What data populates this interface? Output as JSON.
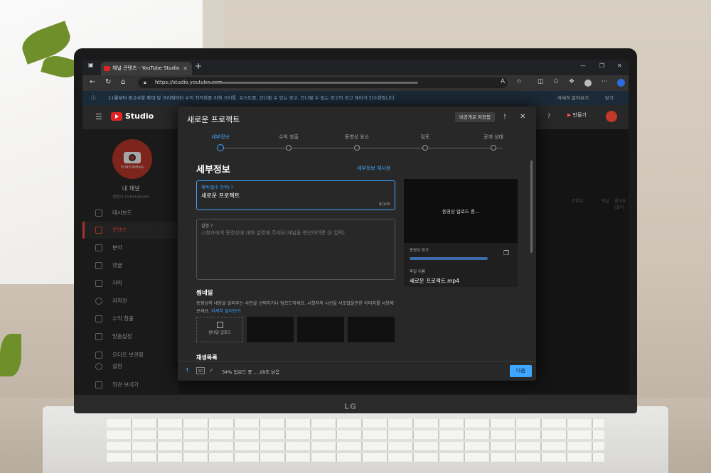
{
  "browser": {
    "tab_title": "채널 콘텐츠 - YouTube Studio",
    "tab_close": "✕",
    "new_tab": "+",
    "url": "https://studio.youtube.com",
    "nav_back": "←",
    "nav_reload": "↻",
    "nav_home": "⌂",
    "win_min": "—",
    "win_max": "❐",
    "win_close": "✕",
    "tool_read": "A",
    "tool_fav": "☆",
    "tool_more": "⋯"
  },
  "banner": {
    "info_icon": "ⓘ",
    "message": "11월부터 광고사항 확대 및 크리에이터 수익 최적화를 위해 크리틀, 포스트를, 건너뛸 수 있는 광고, 건너뛸 수 없는 광고의 광고 제어가 간소화됩니다.",
    "more": "자세히 알아보기",
    "close": "닫기"
  },
  "header": {
    "logo_text": "Studio",
    "menu_icon": "☰",
    "help_icon": "?",
    "create_label": "만들기"
  },
  "sidebar": {
    "avatar_brand": "FUNFUNHAN",
    "channel_title": "내 채널",
    "channel_sub": "맹맹이 FUNFUNHAN",
    "items": [
      {
        "label": "대시보드"
      },
      {
        "label": "콘텐츠"
      },
      {
        "label": "분석"
      },
      {
        "label": "댓글"
      },
      {
        "label": "자막"
      },
      {
        "label": "저작권"
      },
      {
        "label": "수익 창출"
      },
      {
        "label": "맞춤설정"
      },
      {
        "label": "오디오 보관함"
      },
      {
        "label": "설정"
      },
      {
        "label": "의견 보내기"
      }
    ]
  },
  "background_cols": [
    "조회수",
    "댓글",
    "좋아요(싫어"
  ],
  "modal": {
    "title": "새로운 프로젝트",
    "draft_badge": "비공개로 저장됨",
    "feedback_icon": "!",
    "close_icon": "✕",
    "steps": [
      {
        "label": "세부정보",
        "active": true
      },
      {
        "label": "수익 창출",
        "active": false
      },
      {
        "label": "동영상 요소",
        "active": false
      },
      {
        "label": "검토",
        "active": false
      },
      {
        "label": "공개 상태",
        "active": false
      }
    ],
    "section_title": "세부정보",
    "reuse_label": "세부정보 재사용",
    "title_field": {
      "label": "제목(필수 항목)",
      "help": "?",
      "value": "새로운 프로젝트",
      "count": "8/100"
    },
    "desc_field": {
      "label": "설명",
      "help": "?",
      "placeholder": "시청자에게 동영상에 대해 설명해 주세요(채널을 멘션하려면 @ 입력)"
    },
    "thumbnail": {
      "title": "썸네일",
      "desc": "동영상의 내용을 알려주는 사진을 선택하거나 업로드하세요. 시청자의 시선을 사로잡을만한 이미지를 사용해 보세요.",
      "link": "자세히 알아보기",
      "upload_label": "썸네일 업로드"
    },
    "playlist_title": "재생목록",
    "preview": {
      "status": "동영상 업로드 중...",
      "link_label": "동영상 링크",
      "copy_icon": "❐",
      "filename_label": "파일 이름",
      "filename": "새로운 프로젝트.mp4"
    },
    "footer": {
      "upload_icon": "↑",
      "sd_label": "SD",
      "check_icon": "✓",
      "status": "34% 업로드 중 ... 28초 남음",
      "next_label": "다음"
    }
  },
  "device": {
    "brand": "LG"
  }
}
